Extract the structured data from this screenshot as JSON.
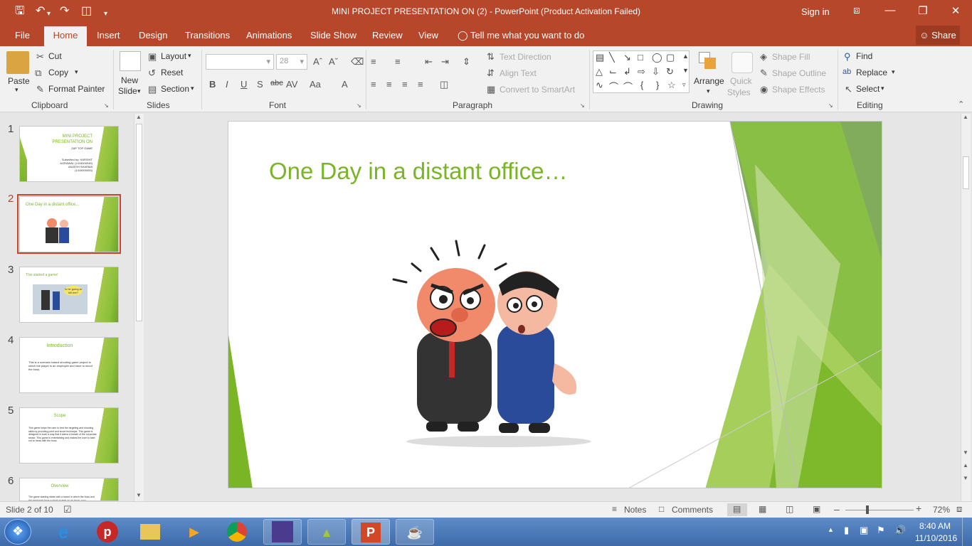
{
  "window": {
    "title": "MINI PROJECT PRESENTATION ON (2)  -  PowerPoint (Product Activation Failed)",
    "sign_in": "Sign in"
  },
  "tabs": [
    "File",
    "Home",
    "Insert",
    "Design",
    "Transitions",
    "Animations",
    "Slide Show",
    "Review",
    "View"
  ],
  "tell_me": "Tell me what you want to do",
  "share": "Share",
  "ribbon": {
    "clipboard": {
      "paste": "Paste",
      "cut": "Cut",
      "copy": "Copy",
      "format_painter": "Format Painter",
      "group": "Clipboard"
    },
    "slides": {
      "new": "New",
      "slide": "Slide",
      "layout": "Layout",
      "reset": "Reset",
      "section": "Section",
      "group": "Slides"
    },
    "font": {
      "size": "28",
      "group": "Font"
    },
    "paragraph": {
      "text_direction": "Text Direction",
      "align_text": "Align Text",
      "smartart": "Convert to SmartArt",
      "group": "Paragraph"
    },
    "drawing": {
      "arrange": "Arrange",
      "quick": "Quick",
      "styles": "Styles",
      "shape_fill": "Shape Fill",
      "shape_outline": "Shape Outline",
      "shape_effects": "Shape Effects",
      "group": "Drawing"
    },
    "editing": {
      "find": "Find",
      "replace": "Replace",
      "select": "Select",
      "group": "Editing"
    }
  },
  "thumbs": [
    {
      "num": "1",
      "title": "MINI PROJECT PRESENTATION ON",
      "subtitle": "ZAP TOP GAME",
      "body": "Submitted by: HARSHIT AGRAWAL (1415000045) ANJESH SHARMA (1415000053)"
    },
    {
      "num": "2",
      "title": "One Day in a distant office..."
    },
    {
      "num": "3",
      "title": "This started a game!",
      "bubble": "Is he going to kill me?"
    },
    {
      "num": "4",
      "title": "Introduction",
      "body": "This is a scenario based shooting game project in which the player is an employee and have to shoot the boss."
    },
    {
      "num": "5",
      "title": "Scope",
      "body": "This game helps the user to test the targeting and shooting skills by providing point and shoot technique. This game is designed in such a way that it stems a breath of the corporate sector. This game is entertaining and makes the user to take not to mess with the boss."
    },
    {
      "num": "6",
      "title": "Overview",
      "body": "The game starting starts with a scene in which the boss and the employee have a short quarrel on an issue, now"
    }
  ],
  "slide": {
    "title": "One Day in a distant office…"
  },
  "status": {
    "slide_of": "Slide 2 of 10",
    "notes": "Notes",
    "comments": "Comments",
    "zoom": "72%"
  },
  "clock": {
    "time": "8:40 AM",
    "date": "11/10/2016"
  },
  "colors": {
    "accent": "#b7472a",
    "slide_green": "#7ab526"
  }
}
